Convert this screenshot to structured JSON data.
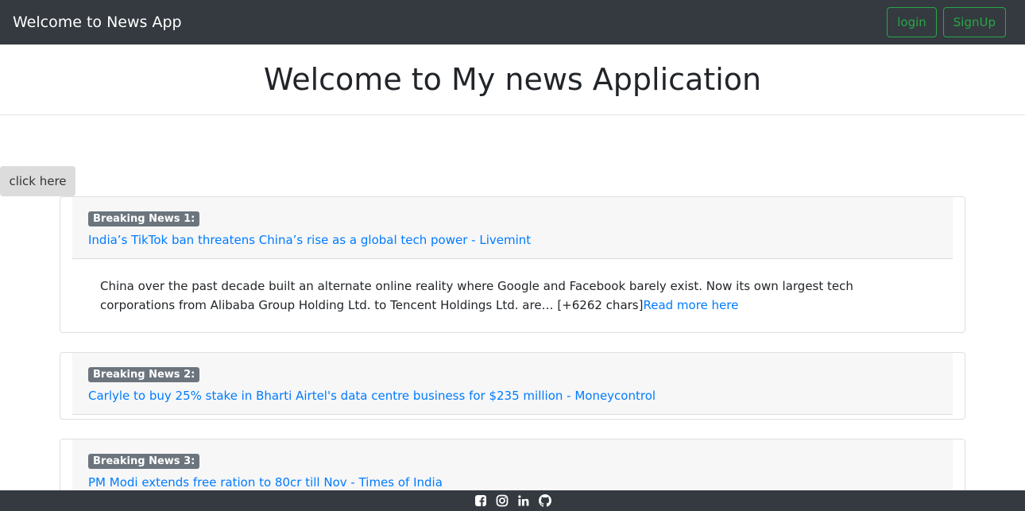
{
  "navbar": {
    "brand": "Welcome to News App",
    "login_label": "login",
    "signup_label": "SignUp"
  },
  "hero": {
    "title": "Welcome to My news Application"
  },
  "click_button": "click here",
  "articles": [
    {
      "badge": "Breaking News 1:",
      "title": "India’s TikTok ban threatens China’s rise as a global tech power - Livemint",
      "description": "China over the past decade built an alternate online reality where Google and Facebook barely exist. Now its own largest tech corporations from Alibaba Group Holding Ltd. to Tencent Holdings Ltd. are… [+6262 chars]",
      "read_more": "Read more here"
    },
    {
      "badge": "Breaking News 2:",
      "title": "Carlyle to buy 25% stake in Bharti Airtel's data centre business for $235 million - Moneycontrol"
    },
    {
      "badge": "Breaking News 3:",
      "title": "PM Modi extends free ration to 80cr till Nov - Times of India"
    }
  ],
  "footer": {
    "icons": [
      "facebook-icon",
      "instagram-icon",
      "linkedin-icon",
      "github-icon"
    ]
  },
  "colors": {
    "navbar_bg": "#343a40",
    "accent_green": "#28a745",
    "link_blue": "#007bff",
    "badge_gray": "#6c757d"
  }
}
